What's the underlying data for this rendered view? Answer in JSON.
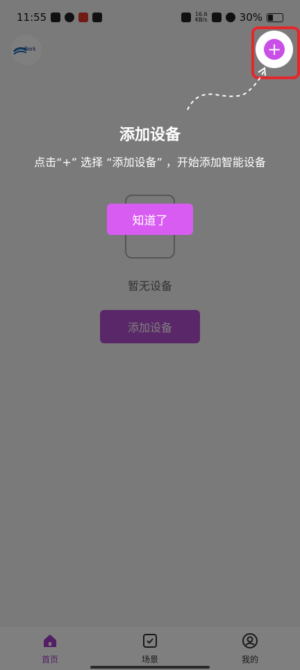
{
  "status": {
    "time": "11:55",
    "net_speed_value": "16.6",
    "net_speed_unit": "KB/s",
    "battery": "30%"
  },
  "brand": {
    "logo_text": "Berk"
  },
  "empty": {
    "text": "暂无设备",
    "add_button": "添加设备"
  },
  "guide": {
    "title": "添加设备",
    "description": "点击“+” 选择 “添加设备” ，开始添加智能设备",
    "got_it": "知道了"
  },
  "plus": {
    "symbol": "+"
  },
  "tabs": [
    {
      "label": "首页",
      "icon": "home-icon",
      "active": true
    },
    {
      "label": "场景",
      "icon": "checkbox-icon",
      "active": false
    },
    {
      "label": "我的",
      "icon": "user-icon",
      "active": false
    }
  ],
  "colors": {
    "accent": "#c94fe6",
    "highlight": "#e4272b",
    "active_tab": "#a43fc8"
  }
}
